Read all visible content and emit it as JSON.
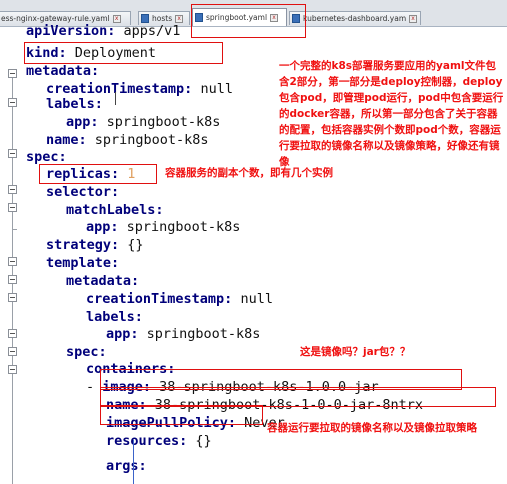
{
  "tabs": [
    {
      "label": "ess-nginx-gateway-rule.yaml",
      "active": false
    },
    {
      "label": "hosts",
      "active": false
    },
    {
      "label": "springboot.yaml",
      "active": true
    },
    {
      "label": "kubernetes-dashboard.yaml",
      "active": false
    }
  ],
  "code_lines": [
    {
      "key": "apiVersion:",
      "value": " apps/v1"
    },
    {
      "key": "kind:",
      "value": " Deployment"
    },
    {
      "key": "metadata:",
      "value": ""
    },
    {
      "key": "creationTimestamp:",
      "value": " null"
    },
    {
      "key": "labels:",
      "value": ""
    },
    {
      "key": "app:",
      "value": " springboot-k8s"
    },
    {
      "key": "name:",
      "value": " springboot-k8s"
    },
    {
      "key": "spec:",
      "value": ""
    },
    {
      "key": "replicas:",
      "value": " 1"
    },
    {
      "key": "selector:",
      "value": ""
    },
    {
      "key": "matchLabels:",
      "value": ""
    },
    {
      "key": "app:",
      "value": " springboot-k8s"
    },
    {
      "key": "strategy:",
      "value": " {}"
    },
    {
      "key": "template:",
      "value": ""
    },
    {
      "key": "metadata:",
      "value": ""
    },
    {
      "key": "creationTimestamp:",
      "value": " null"
    },
    {
      "key": "labels:",
      "value": ""
    },
    {
      "key": "app:",
      "value": " springboot-k8s"
    },
    {
      "key": "spec:",
      "value": ""
    },
    {
      "key": "containers:",
      "value": ""
    },
    {
      "prefix": "- ",
      "key": "image:",
      "value": " 38-springboot-k8s-1.0.0-jar"
    },
    {
      "key": "name:",
      "value": " 38-springboot-k8s-1-0-0-jar-8ntrx"
    },
    {
      "key": "imagePullPolicy:",
      "value": " Never"
    },
    {
      "key": "resources:",
      "value": " {}"
    },
    {
      "key": "",
      "value": ""
    },
    {
      "key": "args:",
      "value": ""
    }
  ],
  "annotations": {
    "deploy_note": "一个完整的k8s部署服务要应用的yaml文件包含2部分，第一部分是deploy控制器，deploy包含pod，即管理pod运行，pod中包含要运行的docker容器，所以第一部分包含了关于容器的配置，包括容器实例个数即pod个数，容器运行要拉取的镜像名称以及镜像策略，好像还有镜像",
    "replicas_note": "容器服务的副本个数，即有几个实例",
    "image_question": "这是镜像吗？jar包？？",
    "pull_policy_note": "容器运行要拉取的镜像名称以及镜像拉取策略"
  }
}
